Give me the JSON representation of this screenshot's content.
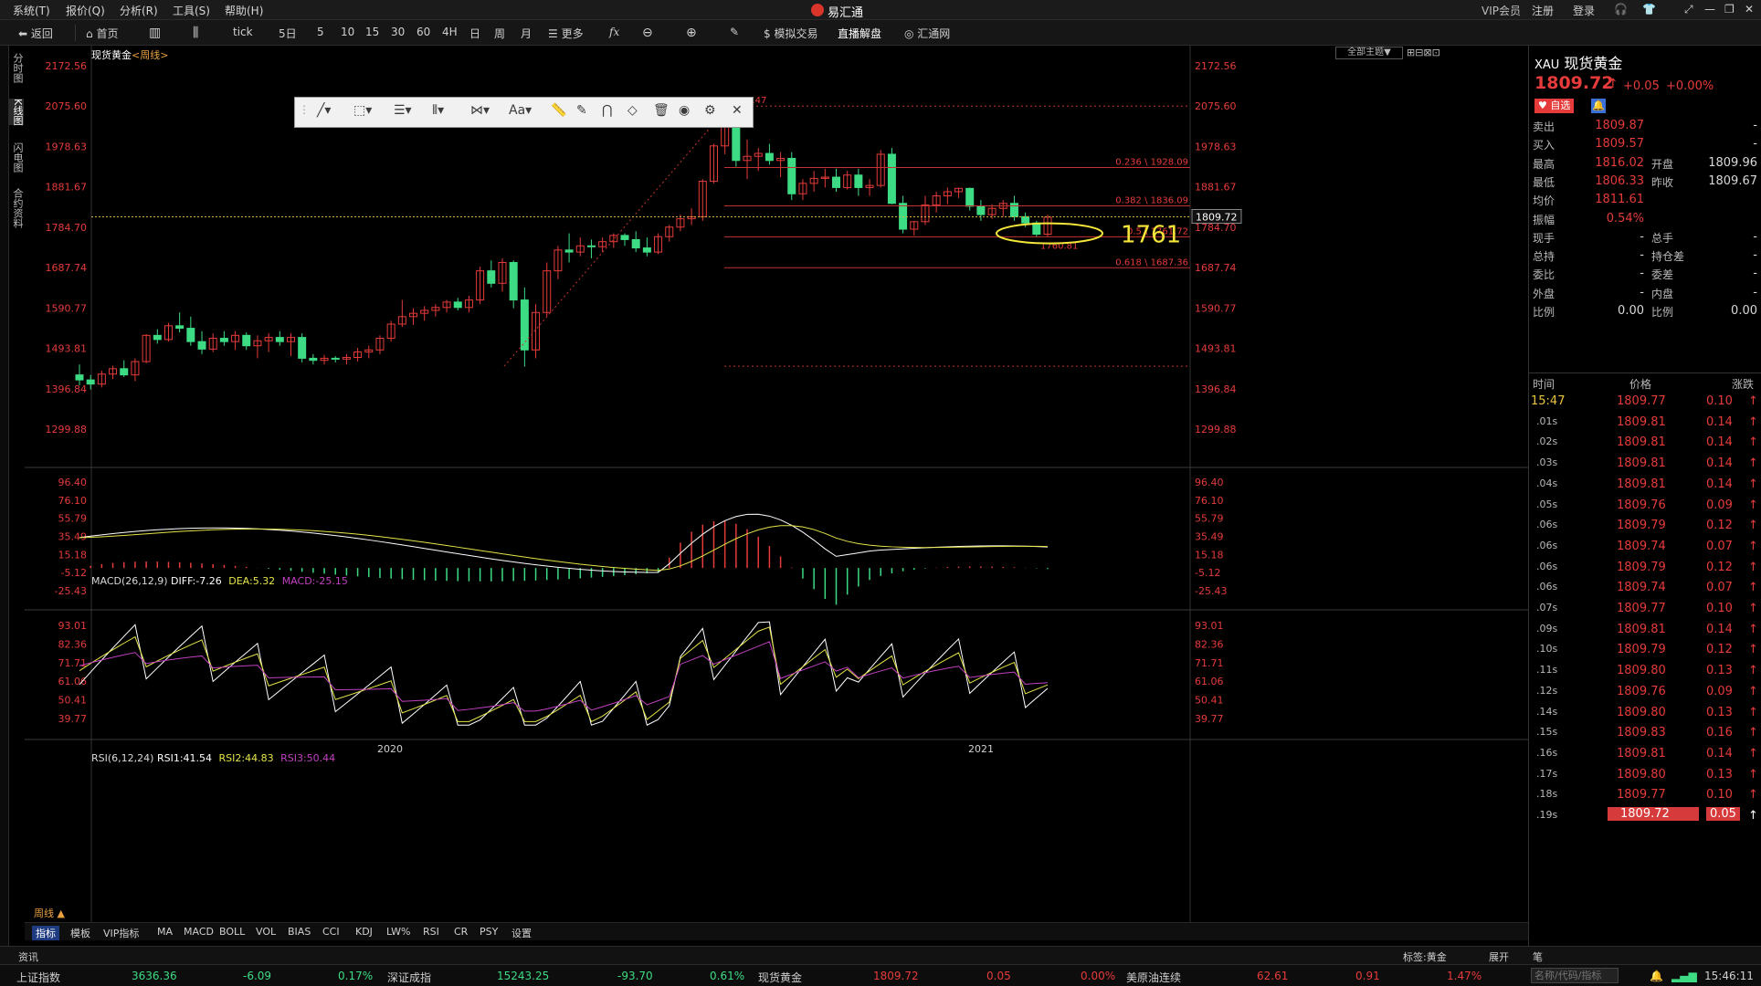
{
  "menubar": {
    "items": [
      "系统(T)",
      "报价(Q)",
      "分析(R)",
      "工具(S)",
      "帮助(H)"
    ],
    "app_title": "易汇通",
    "vip": "VIP会员",
    "register": "注册",
    "login": "登录"
  },
  "toolbar": {
    "back": "返回",
    "home": "首页",
    "tick": "tick",
    "periods": [
      "5日",
      "5",
      "10",
      "15",
      "30",
      "60",
      "4H",
      "日",
      "周",
      "月"
    ],
    "more": "更多",
    "sim_trade": "模拟交易",
    "live": "直播解盘",
    "huitong": "汇通网"
  },
  "left_tabs": [
    "分时图",
    "K线图",
    "闪电图",
    "合约资料"
  ],
  "chart": {
    "header_symbol": "现货黄金",
    "header_period": "<周线>",
    "theme_select": "全部主题▼",
    "price_ticks": [
      "2172.56",
      "2075.60",
      "1978.63",
      "1881.67",
      "1784.70",
      "1687.74",
      "1590.77",
      "1493.81",
      "1396.84",
      "1299.88"
    ],
    "current_price_tag": "1809.72",
    "high_label": "2075.47",
    "low_label": "1760.81",
    "fib_labels": [
      "0.236 \\ 1928.09",
      "0.382 \\ 1836.09",
      "0.5 \\ 1761.72",
      "0.618 \\ 1687.36"
    ],
    "annotation": "1761",
    "x_labels": [
      "2020",
      "2021"
    ],
    "period_label": "周线 ▲"
  },
  "macd": {
    "title": "MACD(26,12,9)",
    "diff": "DIFF:-7.26",
    "dea": "DEA:5.32",
    "macd": "MACD:-25.15",
    "ticks": [
      "96.40",
      "76.10",
      "55.79",
      "35.49",
      "15.18",
      "-5.12",
      "-25.43"
    ]
  },
  "rsi": {
    "title": "RSI(6,12,24)",
    "rsi1": "RSI1:41.54",
    "rsi2": "RSI2:44.83",
    "rsi3": "RSI3:50.44",
    "ticks": [
      "93.01",
      "82.36",
      "71.71",
      "61.06",
      "50.41",
      "39.77"
    ]
  },
  "indicator_tabs": [
    "指标",
    "模板",
    "VIP指标",
    "MA",
    "MACD",
    "BOLL",
    "VOL",
    "BIAS",
    "CCI",
    "KDJ",
    "LW%",
    "RSI",
    "CR",
    "PSY",
    "设置"
  ],
  "quote": {
    "code": "XAU",
    "name": "现货黄金",
    "price": "1809.72",
    "arrow": "↑",
    "change": "+0.05",
    "change_pct": "+0.00%",
    "add_fav": "自选",
    "rows": [
      {
        "l1": "卖出",
        "v1": "1809.87",
        "l2": "",
        "v2": "-"
      },
      {
        "l1": "买入",
        "v1": "1809.57",
        "l2": "",
        "v2": "-"
      },
      {
        "l1": "最高",
        "v1": "1816.02",
        "l2": "开盘",
        "v2": "1809.96"
      },
      {
        "l1": "最低",
        "v1": "1806.33",
        "l2": "昨收",
        "v2": "1809.67"
      },
      {
        "l1": "均价",
        "v1": "1811.61",
        "l2": "",
        "v2": ""
      },
      {
        "l1": "振幅",
        "v1": "0.54%",
        "l2": "",
        "v2": ""
      },
      {
        "l1": "现手",
        "v1": "-",
        "l2": "总手",
        "v2": "-"
      },
      {
        "l1": "总持",
        "v1": "-",
        "l2": "持仓差",
        "v2": "-"
      },
      {
        "l1": "委比",
        "v1": "-",
        "l2": "委差",
        "v2": "-"
      },
      {
        "l1": "外盘",
        "v1": "-",
        "l2": "内盘",
        "v2": "-"
      },
      {
        "l1": "比例",
        "v1": "0.00",
        "l2": "比例",
        "v2": "0.00"
      }
    ],
    "tick_headers": [
      "时间",
      "价格",
      "涨跌"
    ],
    "ticks": [
      {
        "t": "15:47",
        "p": "1809.77",
        "c": "0.10"
      },
      {
        "t": ".01s",
        "p": "1809.81",
        "c": "0.14"
      },
      {
        "t": ".02s",
        "p": "1809.81",
        "c": "0.14"
      },
      {
        "t": ".03s",
        "p": "1809.81",
        "c": "0.14"
      },
      {
        "t": ".04s",
        "p": "1809.81",
        "c": "0.14"
      },
      {
        "t": ".05s",
        "p": "1809.76",
        "c": "0.09"
      },
      {
        "t": ".06s",
        "p": "1809.79",
        "c": "0.12"
      },
      {
        "t": ".06s",
        "p": "1809.74",
        "c": "0.07"
      },
      {
        "t": ".06s",
        "p": "1809.79",
        "c": "0.12"
      },
      {
        "t": ".06s",
        "p": "1809.74",
        "c": "0.07"
      },
      {
        "t": ".07s",
        "p": "1809.77",
        "c": "0.10"
      },
      {
        "t": ".09s",
        "p": "1809.81",
        "c": "0.14"
      },
      {
        "t": ".10s",
        "p": "1809.79",
        "c": "0.12"
      },
      {
        "t": ".11s",
        "p": "1809.80",
        "c": "0.13"
      },
      {
        "t": ".12s",
        "p": "1809.76",
        "c": "0.09"
      },
      {
        "t": ".14s",
        "p": "1809.80",
        "c": "0.13"
      },
      {
        "t": ".15s",
        "p": "1809.83",
        "c": "0.16"
      },
      {
        "t": ".16s",
        "p": "1809.81",
        "c": "0.14"
      },
      {
        "t": ".17s",
        "p": "1809.80",
        "c": "0.13"
      },
      {
        "t": ".18s",
        "p": "1809.77",
        "c": "0.10"
      },
      {
        "t": ".19s",
        "p": "1809.72",
        "c": "0.05"
      }
    ]
  },
  "news": {
    "label": "资讯",
    "tag": "标签:黄金",
    "expand": "展开",
    "tab": "笔"
  },
  "ticker": [
    {
      "name": "上证指数",
      "v": "3636.36",
      "c": "-6.09",
      "p": "0.17%"
    },
    {
      "name": "深证成指",
      "v": "15243.25",
      "c": "-93.70",
      "p": "0.61%"
    },
    {
      "name": "现货黄金",
      "v": "1809.72",
      "c": "0.05",
      "p": "0.00%"
    },
    {
      "name": "美原油连续",
      "v": "62.61",
      "c": "0.91",
      "p": "1.47%"
    }
  ],
  "statusbar": {
    "search_placeholder": "名称/代码/指标",
    "time": "15:46:11"
  },
  "colors": {
    "up": "#e53b3b",
    "down": "#3ddc84",
    "diff": "#ffffff",
    "dea": "#e4e44a",
    "macd_label": "#c040c0"
  }
}
